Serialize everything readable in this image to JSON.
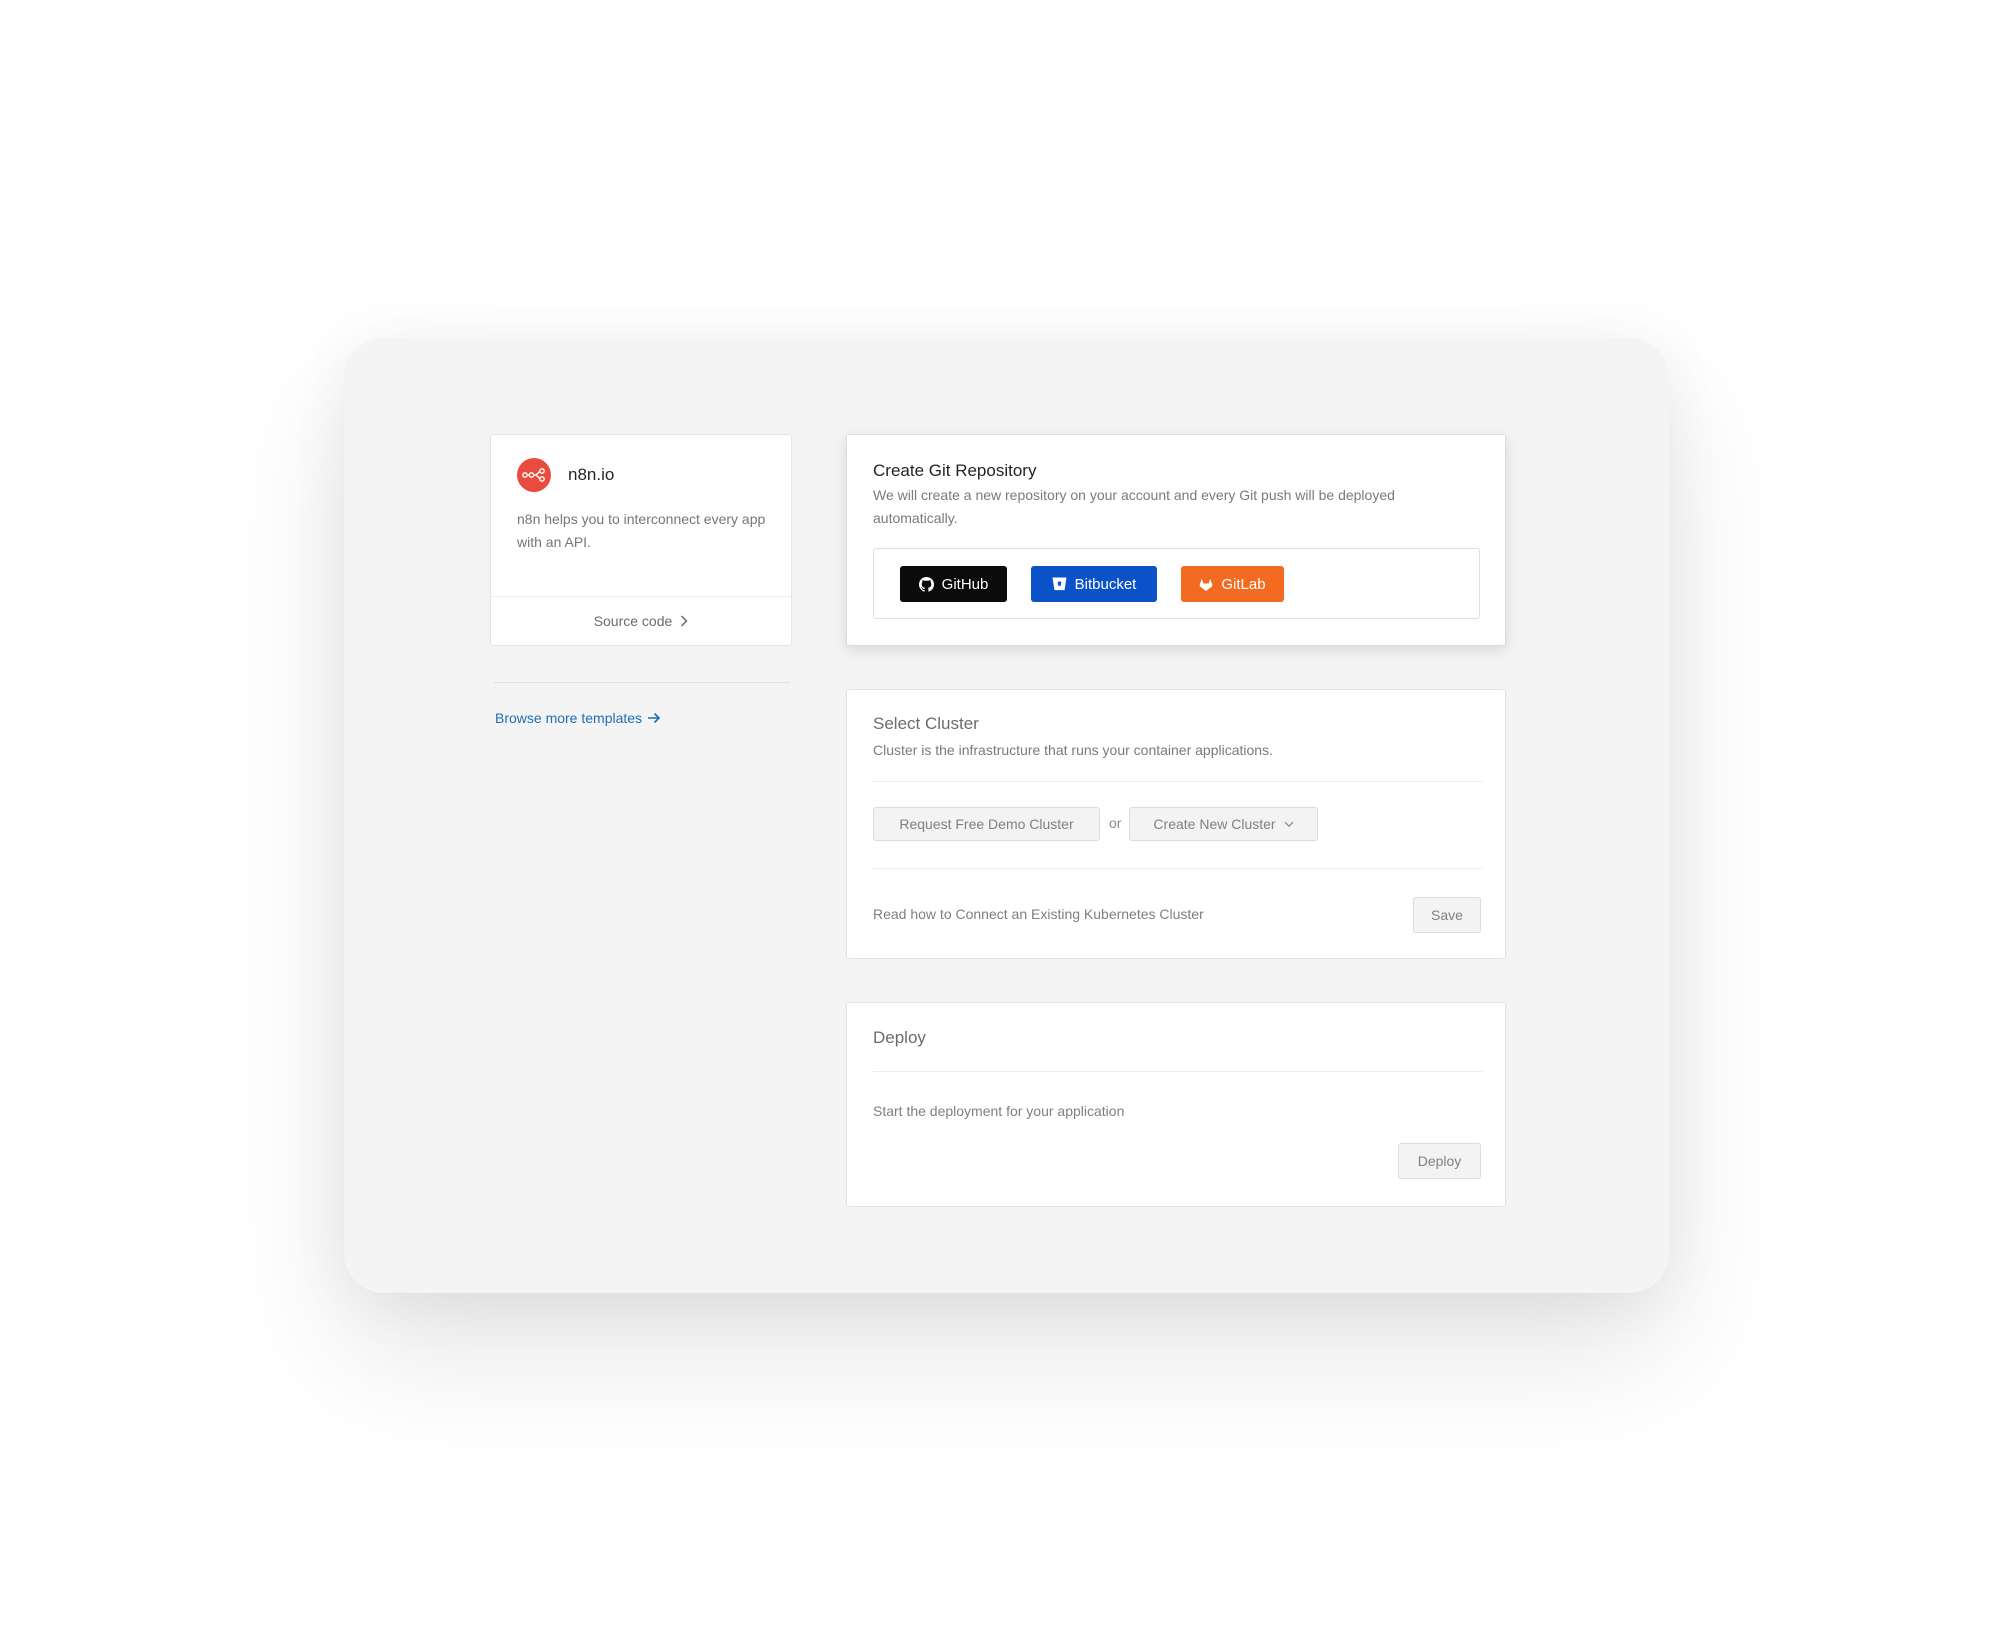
{
  "template": {
    "name": "n8n.io",
    "description": "n8n helps you to interconnect every app with an API.",
    "source_label": "Source code",
    "logo_icon": "n8n-logo-icon",
    "brand_color": "#ea4b3f"
  },
  "browse": {
    "label": "Browse more templates"
  },
  "git": {
    "title": "Create Git Repository",
    "subtitle": "We will create a new repository on your account and every Git push will be deployed automatically.",
    "providers": [
      {
        "label": "GitHub",
        "icon": "github-icon",
        "color": "#0b0b0b"
      },
      {
        "label": "Bitbucket",
        "icon": "bitbucket-icon",
        "color": "#0b52c9"
      },
      {
        "label": "GitLab",
        "icon": "gitlab-icon",
        "color": "#f26b21"
      }
    ]
  },
  "cluster": {
    "title": "Select Cluster",
    "subtitle": "Cluster is the infrastructure that runs your container applications.",
    "demo_button": "Request Free Demo Cluster",
    "or_label": "or",
    "create_button": "Create New Cluster",
    "connect_text": "Read how to Connect an Existing Kubernetes Cluster",
    "save_button": "Save"
  },
  "deploy": {
    "title": "Deploy",
    "description": "Start the deployment for your application",
    "deploy_button": "Deploy"
  }
}
